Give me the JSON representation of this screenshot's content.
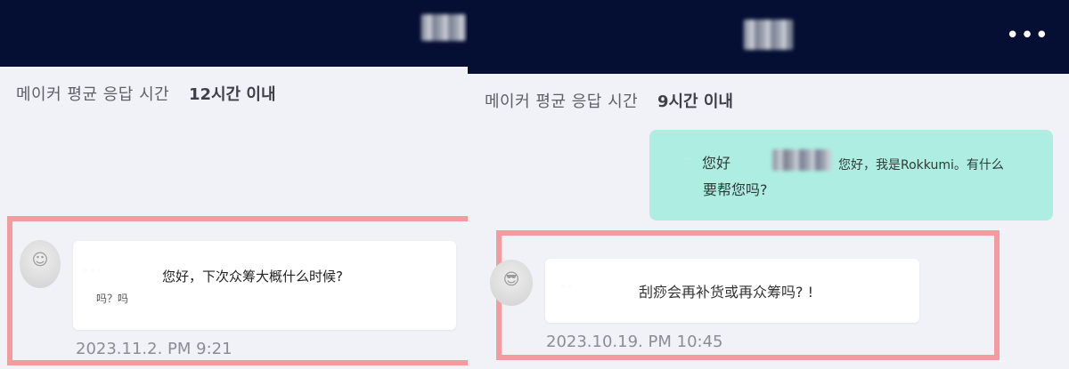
{
  "left": {
    "response": {
      "label": "메이커 평균 응답 시간",
      "value": "12시간 이내"
    },
    "message": {
      "main": "您好，下次众筹大概什么时候?",
      "sub": "吗？吗"
    },
    "timestamp": "2023.11.2. PM 9:21"
  },
  "right": {
    "more_label": "•••",
    "response": {
      "label": "메이커 평균 응답 시간",
      "value": "9시간 이내"
    },
    "sent_message": {
      "line1a": "您好",
      "line1b": "您好，我是Rokkumi。有什么",
      "line2": "要帮您吗?"
    },
    "message": {
      "main": "刮痧会再补货或再众筹吗? !"
    },
    "timestamp": "2023.10.19. PM 10:45"
  },
  "colors": {
    "header": "#050e33",
    "background": "#f1f2f7",
    "highlight": "#f39b9d",
    "sent_bubble": "#aeeee2"
  },
  "icons": {
    "more": "more-horizontal-icon",
    "avatar": "user-avatar"
  }
}
